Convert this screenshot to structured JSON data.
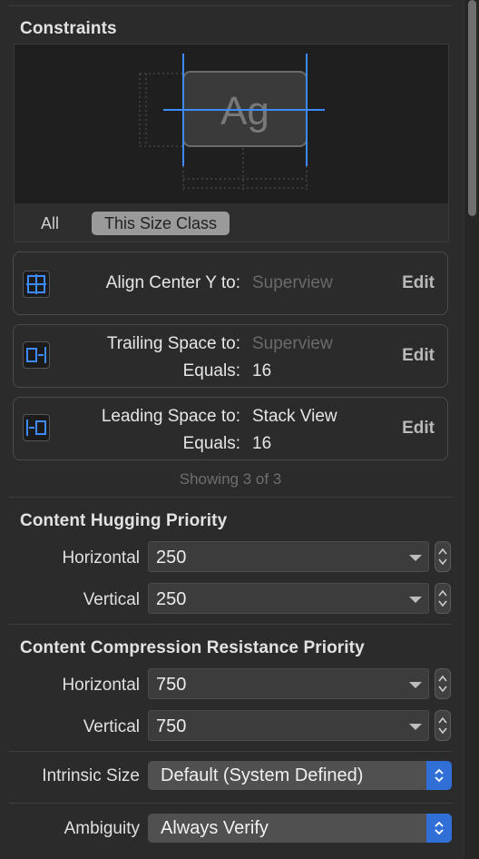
{
  "constraints": {
    "title": "Constraints",
    "preview": {
      "sample_text": "Ag"
    },
    "segments": {
      "all": "All",
      "size_class": "This Size Class"
    },
    "items": [
      {
        "icon": "align-center-y-icon",
        "label1": "Align Center Y to:",
        "value1": "Superview",
        "edit": "Edit"
      },
      {
        "icon": "trailing-space-icon",
        "label1": "Trailing Space to:",
        "value1": "Superview",
        "label2": "Equals:",
        "value2": "16",
        "edit": "Edit"
      },
      {
        "icon": "leading-space-icon",
        "label1": "Leading Space to:",
        "value1": "Stack View",
        "label2": "Equals:",
        "value2": "16",
        "edit": "Edit"
      }
    ],
    "showing": "Showing 3 of 3"
  },
  "hugging": {
    "title": "Content Hugging Priority",
    "horizontal_label": "Horizontal",
    "horizontal_value": "250",
    "vertical_label": "Vertical",
    "vertical_value": "250"
  },
  "compression": {
    "title": "Content Compression Resistance Priority",
    "horizontal_label": "Horizontal",
    "horizontal_value": "750",
    "vertical_label": "Vertical",
    "vertical_value": "750"
  },
  "intrinsic": {
    "label": "Intrinsic Size",
    "value": "Default (System Defined)"
  },
  "ambiguity": {
    "label": "Ambiguity",
    "value": "Always Verify"
  },
  "colors": {
    "accent": "#2f6fd6",
    "constraint_line": "#3d8bff",
    "background": "#2b2b2b"
  }
}
